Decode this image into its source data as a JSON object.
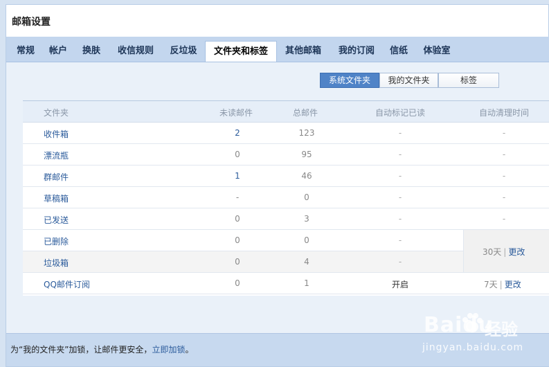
{
  "window": {
    "title": "邮箱设置"
  },
  "tabs": [
    {
      "label": "常规",
      "active": false
    },
    {
      "label": "帐户",
      "active": false
    },
    {
      "label": "换肤",
      "active": false
    },
    {
      "label": "收信规则",
      "active": false
    },
    {
      "label": "反垃圾",
      "active": false
    },
    {
      "label": "文件夹和标签",
      "active": true
    },
    {
      "label": "其他邮箱",
      "active": false
    },
    {
      "label": "我的订阅",
      "active": false
    },
    {
      "label": "信纸",
      "active": false
    },
    {
      "label": "体验室",
      "active": false
    }
  ],
  "segment": {
    "system_folders": "系统文件夹",
    "my_folders": "我的文件夹",
    "labels": "标签",
    "selected": "系统文件夹"
  },
  "table": {
    "headers": [
      "文件夹",
      "未读邮件",
      "总邮件",
      "自动标记已读",
      "自动清理时间"
    ],
    "rows": [
      {
        "name": "收件箱",
        "unread": "2",
        "total": "123",
        "auto_read": "-",
        "auto_clean": "-"
      },
      {
        "name": "漂流瓶",
        "unread": "0",
        "total": "95",
        "auto_read": "-",
        "auto_clean": "-"
      },
      {
        "name": "群邮件",
        "unread": "1",
        "total": "46",
        "auto_read": "-",
        "auto_clean": "-"
      },
      {
        "name": "草稿箱",
        "unread": "-",
        "total": "0",
        "auto_read": "-",
        "auto_clean": "-"
      },
      {
        "name": "已发送",
        "unread": "0",
        "total": "3",
        "auto_read": "-",
        "auto_clean": "-"
      },
      {
        "name": "已删除",
        "unread": "0",
        "total": "0",
        "auto_read": "-",
        "auto_clean": ""
      },
      {
        "name": "垃圾箱",
        "unread": "0",
        "total": "4",
        "auto_read": "-",
        "auto_clean": ""
      },
      {
        "name": "QQ邮件订阅",
        "unread": "0",
        "total": "1",
        "auto_read": "开启",
        "auto_clean": "7天"
      }
    ],
    "merged_clean": {
      "days": "30天",
      "edit": "更改"
    },
    "edit_label": "更改",
    "separator": "|"
  },
  "footer": {
    "text_before": "为“我的文件夹”加锁，让邮件更安全，",
    "link": "立即加锁",
    "text_after": "。"
  },
  "watermark": {
    "logo": "Baidu",
    "cn": "经验",
    "url": "jingyan.baidu.com"
  },
  "colors": {
    "accent": "#4f83c7",
    "link": "#2b5b9b",
    "tabbar": "#c3d6ee",
    "footer": "#c7d9ef"
  }
}
